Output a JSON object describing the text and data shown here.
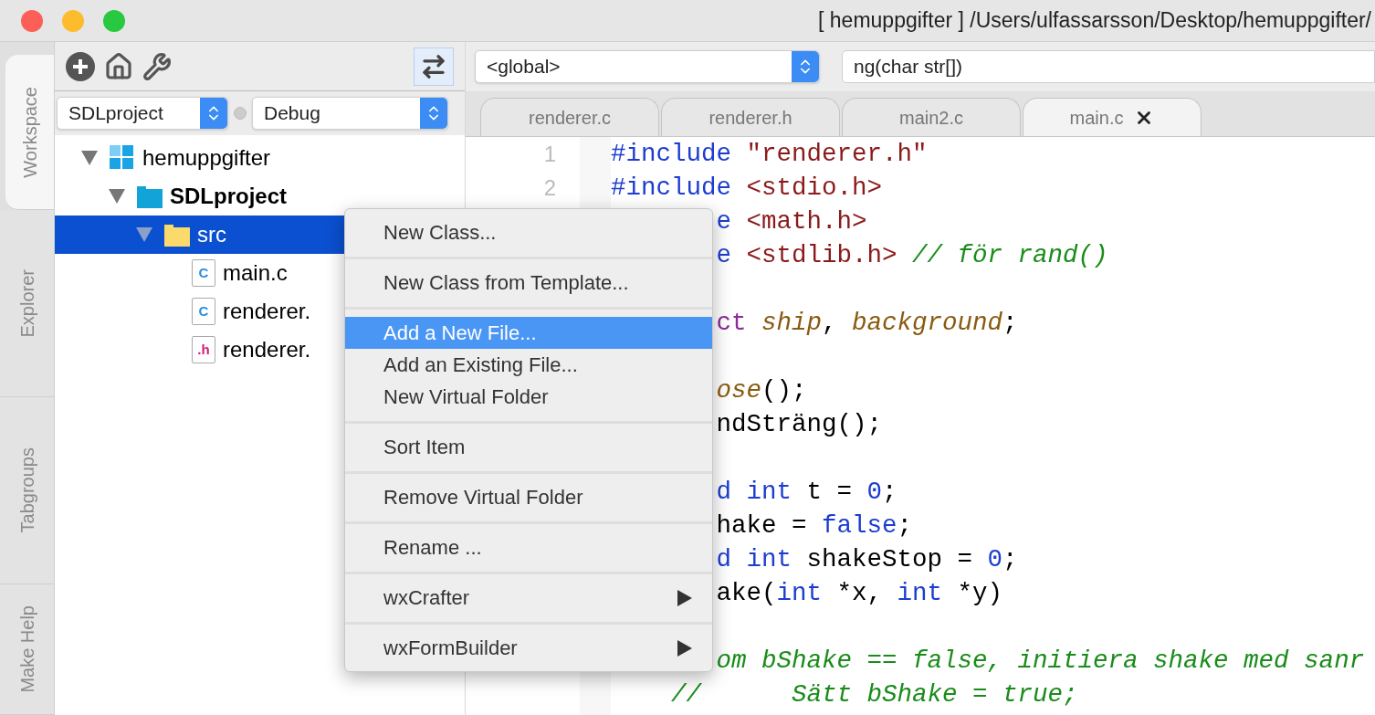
{
  "window": {
    "title": "[ hemuppgifter ] /Users/ulfassarsson/Desktop/hemuppgifter/"
  },
  "side_tabs": [
    {
      "label": "Workspace",
      "selected": true
    },
    {
      "label": "Explorer",
      "selected": false
    },
    {
      "label": "Tabgroups",
      "selected": false
    },
    {
      "label": "Make Help",
      "selected": false
    }
  ],
  "workspace": {
    "project_select": "SDLproject",
    "config_select": "Debug",
    "tree": [
      {
        "label": "hemuppgifter",
        "kind": "workspace",
        "expanded": true,
        "selected": false,
        "children": [
          {
            "label": "SDLproject",
            "kind": "project",
            "expanded": true,
            "selected": false,
            "children": [
              {
                "label": "src",
                "kind": "folder",
                "expanded": true,
                "selected": true,
                "children": [
                  {
                    "label": "main.c",
                    "kind": "file",
                    "badge": "C",
                    "selected": false
                  },
                  {
                    "label": "renderer.",
                    "kind": "file",
                    "badge": "C",
                    "selected": false
                  },
                  {
                    "label": "renderer.",
                    "kind": "file",
                    "badge": ".h",
                    "selected": false
                  }
                ]
              }
            ]
          }
        ]
      }
    ]
  },
  "editor": {
    "scope_select": "<global>",
    "function_field": "ng(char str[])",
    "tabs": [
      {
        "label": "renderer.c",
        "selected": false
      },
      {
        "label": "renderer.h",
        "selected": false
      },
      {
        "label": "main2.c",
        "selected": false
      },
      {
        "label": "main.c",
        "selected": true
      }
    ],
    "lines": [
      {
        "kind": "code",
        "number": "1",
        "covered": false,
        "tokens": [
          {
            "kind": "keyword",
            "text": "#include"
          },
          {
            "kind": "string",
            "text": " \"renderer.h\""
          }
        ]
      },
      {
        "kind": "code",
        "number": "2",
        "covered": false,
        "tokens": [
          {
            "kind": "keyword",
            "text": "#include"
          },
          {
            "kind": "string",
            "text": " <stdio.h>"
          }
        ]
      },
      {
        "kind": "code",
        "covered": true,
        "tokens": [
          {
            "kind": "keyword",
            "text": "e"
          },
          {
            "kind": "string",
            "text": " <math.h>"
          }
        ]
      },
      {
        "kind": "code",
        "covered": true,
        "tokens": [
          {
            "kind": "keyword",
            "text": "e"
          },
          {
            "kind": "string",
            "text": " <stdlib.h>"
          },
          {
            "kind": "comment",
            "text": " // för rand()"
          }
        ]
      },
      {
        "kind": "blank"
      },
      {
        "kind": "code",
        "covered": true,
        "tokens": [
          {
            "kind": "type",
            "text": "ct"
          },
          {
            "kind": "ident",
            "text": " ship"
          },
          {
            "kind": "plain",
            "text": ", "
          },
          {
            "kind": "ident",
            "text": "background"
          },
          {
            "kind": "plain",
            "text": ";"
          }
        ]
      },
      {
        "kind": "blank"
      },
      {
        "kind": "code",
        "covered": true,
        "tokens": [
          {
            "kind": "ident",
            "text": "ose"
          },
          {
            "kind": "plain",
            "text": "();"
          }
        ]
      },
      {
        "kind": "code",
        "covered": true,
        "tokens": [
          {
            "kind": "plain",
            "text": "ndSträng();"
          }
        ]
      },
      {
        "kind": "blank"
      },
      {
        "kind": "code",
        "covered": true,
        "tokens": [
          {
            "kind": "keyword",
            "text": "d int"
          },
          {
            "kind": "plain",
            "text": " t = "
          },
          {
            "kind": "number",
            "text": "0"
          },
          {
            "kind": "plain",
            "text": ";"
          }
        ]
      },
      {
        "kind": "code",
        "covered": true,
        "tokens": [
          {
            "kind": "plain",
            "text": "hake = "
          },
          {
            "kind": "keyword",
            "text": "false"
          },
          {
            "kind": "plain",
            "text": ";"
          }
        ]
      },
      {
        "kind": "code",
        "covered": true,
        "tokens": [
          {
            "kind": "keyword",
            "text": "d int"
          },
          {
            "kind": "plain",
            "text": " shakeStop = "
          },
          {
            "kind": "number",
            "text": "0"
          },
          {
            "kind": "plain",
            "text": ";"
          }
        ]
      },
      {
        "kind": "code",
        "covered": true,
        "tokens": [
          {
            "kind": "plain",
            "text": "ake("
          },
          {
            "kind": "keyword",
            "text": "int"
          },
          {
            "kind": "plain",
            "text": " *x, "
          },
          {
            "kind": "keyword",
            "text": "int"
          },
          {
            "kind": "plain",
            "text": " *y)"
          }
        ]
      },
      {
        "kind": "blank"
      },
      {
        "kind": "code",
        "covered": true,
        "tokens": [
          {
            "kind": "comment",
            "text": "om bShake == false, initiera shake med sanr"
          }
        ]
      },
      {
        "kind": "code",
        "covered": false,
        "tokens": [
          {
            "kind": "comment",
            "text": "    //      Sätt bShake = true;"
          }
        ]
      }
    ]
  },
  "context_menu": {
    "items": [
      {
        "kind": "item",
        "label": "New Class...",
        "selected": false,
        "submenu": false
      },
      {
        "kind": "separator"
      },
      {
        "kind": "item",
        "label": "New Class from Template...",
        "selected": false,
        "submenu": false
      },
      {
        "kind": "separator"
      },
      {
        "kind": "item",
        "label": "Add a New File...",
        "selected": true,
        "submenu": false
      },
      {
        "kind": "item",
        "label": "Add an Existing File...",
        "selected": false,
        "submenu": false
      },
      {
        "kind": "item",
        "label": "New Virtual Folder",
        "selected": false,
        "submenu": false
      },
      {
        "kind": "separator"
      },
      {
        "kind": "item",
        "label": "Sort Item",
        "selected": false,
        "submenu": false
      },
      {
        "kind": "separator"
      },
      {
        "kind": "item",
        "label": "Remove Virtual Folder",
        "selected": false,
        "submenu": false
      },
      {
        "kind": "separator"
      },
      {
        "kind": "item",
        "label": "Rename ...",
        "selected": false,
        "submenu": false
      },
      {
        "kind": "separator"
      },
      {
        "kind": "item",
        "label": "wxCrafter",
        "selected": false,
        "submenu": true
      },
      {
        "kind": "separator"
      },
      {
        "kind": "item",
        "label": "wxFormBuilder",
        "selected": false,
        "submenu": true
      }
    ]
  }
}
